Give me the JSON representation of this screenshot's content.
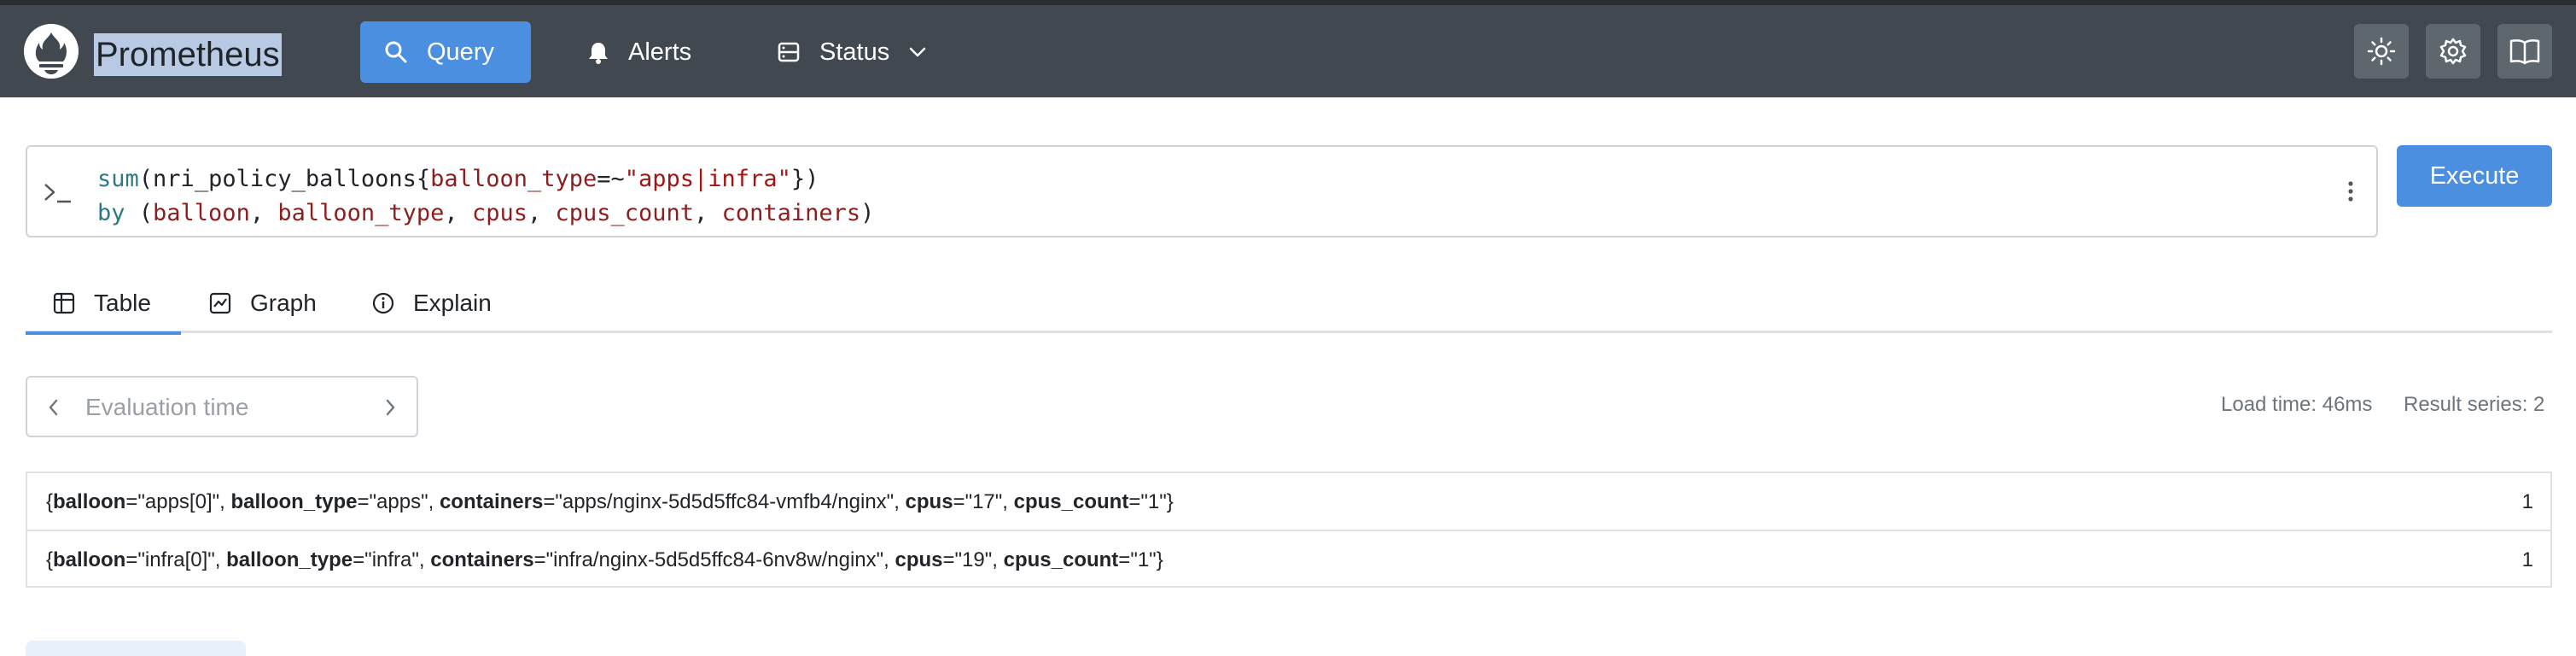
{
  "app": {
    "brand": "Prometheus"
  },
  "nav": {
    "items": [
      {
        "label": "Query",
        "icon": "search-icon",
        "active": true
      },
      {
        "label": "Alerts",
        "icon": "bell-icon"
      },
      {
        "label": "Status",
        "icon": "server-icon",
        "has_dropdown": true
      }
    ],
    "icon_buttons": [
      "sun-icon",
      "gear-icon",
      "book-icon"
    ]
  },
  "query": {
    "line1": {
      "fn": "sum",
      "open": "(",
      "metric": "nri_policy_balloons",
      "brace_open": "{",
      "label": "balloon_type",
      "op": "=~",
      "value": "\"apps|infra\"",
      "close": "})"
    },
    "line2": {
      "kw": "by",
      "open": " (",
      "labels": [
        "balloon",
        "balloon_type",
        "cpus",
        "cpus_count",
        "containers"
      ],
      "sep": ", ",
      "close": ")"
    }
  },
  "execute_label": "Execute",
  "tabs": [
    {
      "label": "Table",
      "icon": "table-icon",
      "active": true
    },
    {
      "label": "Graph",
      "icon": "chart-icon"
    },
    {
      "label": "Explain",
      "icon": "info-icon"
    }
  ],
  "eval_time": {
    "placeholder": "Evaluation time"
  },
  "stats": {
    "load_time": "Load time: 46ms",
    "result_series": "Result series: 2"
  },
  "results": [
    {
      "parts": [
        [
          "balloon",
          "\"apps[0]\""
        ],
        [
          "balloon_type",
          "\"apps\""
        ],
        [
          "containers",
          "\"apps/nginx-5d5d5ffc84-vmfb4/nginx\""
        ],
        [
          "cpus",
          "\"17\""
        ],
        [
          "cpus_count",
          "\"1\""
        ]
      ],
      "value": "1"
    },
    {
      "parts": [
        [
          "balloon",
          "\"infra[0]\""
        ],
        [
          "balloon_type",
          "\"infra\""
        ],
        [
          "containers",
          "\"infra/nginx-5d5d5ffc84-6nv8w/nginx\""
        ],
        [
          "cpus",
          "\"19\""
        ],
        [
          "cpus_count",
          "\"1\""
        ]
      ],
      "value": "1"
    }
  ],
  "colors": {
    "nav_bg": "#414850",
    "accent": "#4b8fe0",
    "string": "#a31515",
    "label": "#8b1e1e",
    "function": "#2c7a86"
  }
}
